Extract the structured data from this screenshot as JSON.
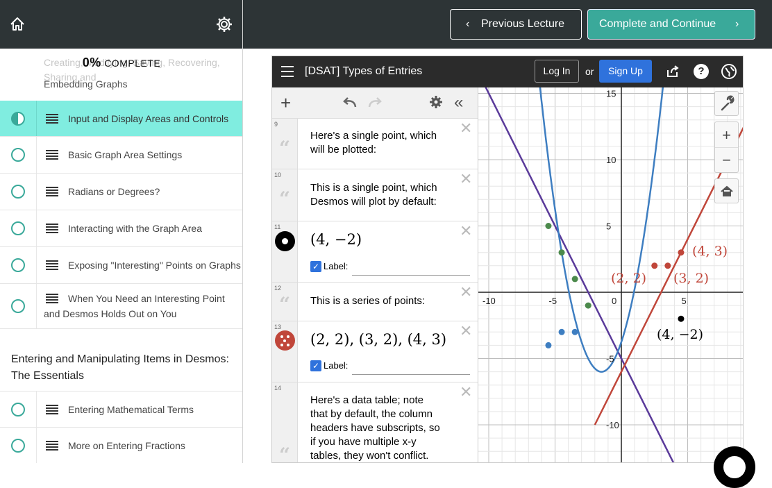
{
  "sidebar": {
    "progress_percent": "0%",
    "progress_label": "COMPLETE",
    "faded_item_last_line": "Embedding Graphs",
    "faded_item_partial": "Creating, Modifying, Saving, Recovering, Sharing and",
    "lectures_a": [
      {
        "label": "Input and Display Areas and Controls"
      },
      {
        "label": "Basic Graph Area Settings"
      },
      {
        "label": "Radians or Degrees?"
      },
      {
        "label": "Interacting with the Graph Area"
      },
      {
        "label": "Exposing \"Interesting\" Points on Graphs"
      }
    ],
    "lecture_wrap_line1": "When You Need an Interesting Point",
    "lecture_wrap_line2": "and Desmos Holds Out on You",
    "section_title": "Entering and Manipulating Items in Desmos: The Essentials",
    "lectures_b": [
      {
        "label": "Entering Mathematical Terms"
      },
      {
        "label": "More on Entering Fractions"
      }
    ]
  },
  "topbar": {
    "prev_label": "Previous Lecture",
    "next_label": "Complete and Continue"
  },
  "desmos": {
    "title": "[DSAT] Types of Entries",
    "login": "Log In",
    "or": "or",
    "signup": "Sign Up",
    "label_text": "Label:",
    "expressions": [
      {
        "num": "9",
        "text_1": "Here's a single point, which",
        "text_2": "will be plotted:"
      },
      {
        "num": "10",
        "text_1": "This is a single point, which",
        "text_2": "Desmos will plot by default:"
      },
      {
        "num": "11",
        "math": "(4, −2)"
      },
      {
        "num": "12",
        "text_1": "This is a series of points:"
      },
      {
        "num": "13",
        "math": "(2, 2), (3, 2), (4, 3)"
      },
      {
        "num": "14",
        "lines": [
          "Here's a data table; note",
          "that by default, the column",
          "headers have subscripts, so",
          "if you have multiple x-y",
          "tables, they won't conflict."
        ]
      }
    ],
    "x_ticks": [
      "-10",
      "-5",
      "0",
      "5"
    ],
    "y_ticks": [
      "15",
      "10",
      "5",
      "-5",
      "-10"
    ],
    "point_labels": [
      "(4, 3)",
      "(2, 2)",
      "(3, 2)",
      "(4, −2)"
    ],
    "colors": {
      "teal": "#3aa99a",
      "purple": "#5a3a9a",
      "blue": "#3e7ec1",
      "red": "#c0463a",
      "green": "#4c8a4c"
    }
  }
}
